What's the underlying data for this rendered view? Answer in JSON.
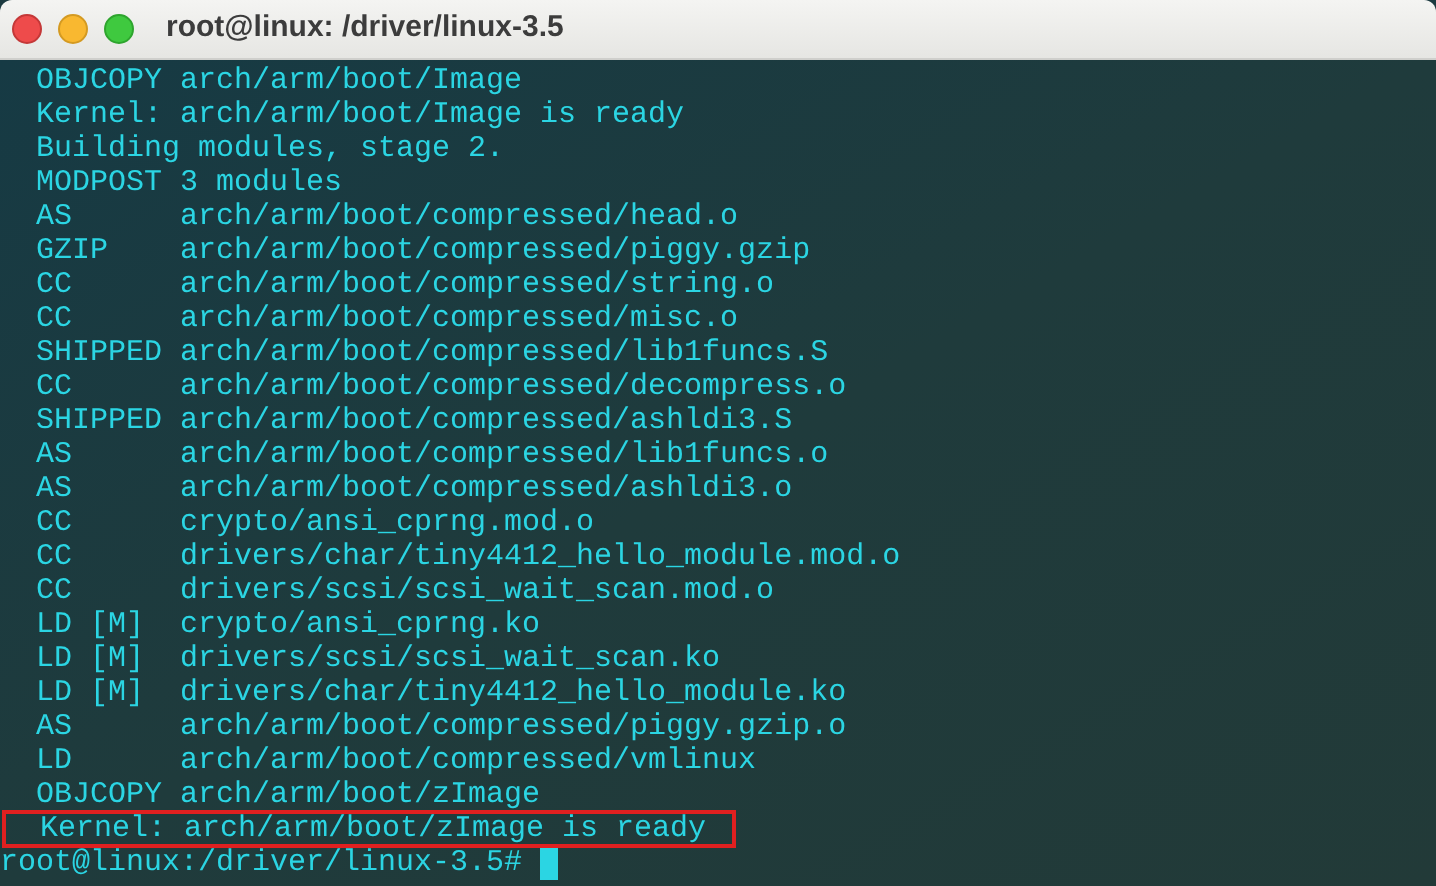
{
  "window": {
    "title": "root@linux: /driver/linux-3.5"
  },
  "lines": [
    {
      "text": "  OBJCOPY arch/arm/boot/Image",
      "highlighted": false
    },
    {
      "text": "  Kernel: arch/arm/boot/Image is ready",
      "highlighted": false
    },
    {
      "text": "  Building modules, stage 2.",
      "highlighted": false
    },
    {
      "text": "  MODPOST 3 modules",
      "highlighted": false
    },
    {
      "text": "  AS      arch/arm/boot/compressed/head.o",
      "highlighted": false
    },
    {
      "text": "  GZIP    arch/arm/boot/compressed/piggy.gzip",
      "highlighted": false
    },
    {
      "text": "  CC      arch/arm/boot/compressed/string.o",
      "highlighted": false
    },
    {
      "text": "  CC      arch/arm/boot/compressed/misc.o",
      "highlighted": false
    },
    {
      "text": "  SHIPPED arch/arm/boot/compressed/lib1funcs.S",
      "highlighted": false
    },
    {
      "text": "  CC      arch/arm/boot/compressed/decompress.o",
      "highlighted": false
    },
    {
      "text": "  SHIPPED arch/arm/boot/compressed/ashldi3.S",
      "highlighted": false
    },
    {
      "text": "  AS      arch/arm/boot/compressed/lib1funcs.o",
      "highlighted": false
    },
    {
      "text": "  AS      arch/arm/boot/compressed/ashldi3.o",
      "highlighted": false
    },
    {
      "text": "  CC      crypto/ansi_cprng.mod.o",
      "highlighted": false
    },
    {
      "text": "  CC      drivers/char/tiny4412_hello_module.mod.o",
      "highlighted": false
    },
    {
      "text": "  CC      drivers/scsi/scsi_wait_scan.mod.o",
      "highlighted": false
    },
    {
      "text": "  LD [M]  crypto/ansi_cprng.ko",
      "highlighted": false
    },
    {
      "text": "  LD [M]  drivers/scsi/scsi_wait_scan.ko",
      "highlighted": false
    },
    {
      "text": "  LD [M]  drivers/char/tiny4412_hello_module.ko",
      "highlighted": false
    },
    {
      "text": "  AS      arch/arm/boot/compressed/piggy.gzip.o",
      "highlighted": false
    },
    {
      "text": "  LD      arch/arm/boot/compressed/vmlinux",
      "highlighted": false
    },
    {
      "text": "  OBJCOPY arch/arm/boot/zImage",
      "highlighted": false
    },
    {
      "text": "  Kernel: arch/arm/boot/zImage is ready",
      "highlighted": true
    }
  ],
  "prompt": {
    "text": "root@linux:/driver/linux-3.5# "
  }
}
